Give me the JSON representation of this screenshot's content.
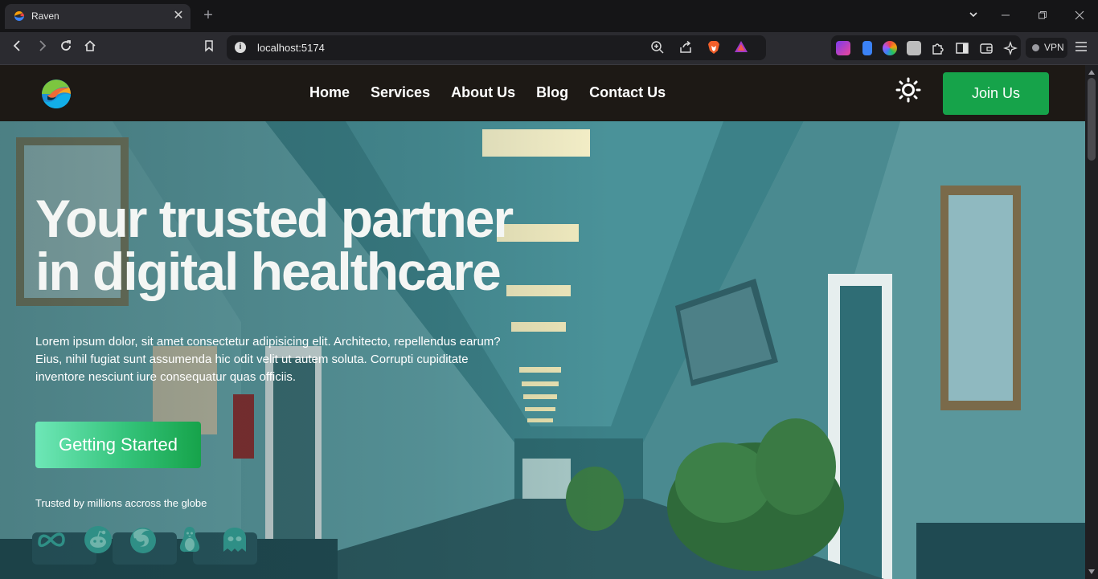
{
  "browser": {
    "tab_title": "Raven",
    "tab_close": "✕",
    "new_tab": "+",
    "url": "localhost:5174",
    "vpn_label": "VPN"
  },
  "site": {
    "nav": {
      "items": [
        {
          "label": "Home"
        },
        {
          "label": "Services"
        },
        {
          "label": "About Us"
        },
        {
          "label": "Blog"
        },
        {
          "label": "Contact Us"
        }
      ],
      "theme_icon": "sun-icon",
      "join_label": "Join Us"
    },
    "hero": {
      "headline_line1": "Your trusted partner",
      "headline_line2": "in digital healthcare",
      "body": "Lorem ipsum dolor, sit amet consectetur adipisicing elit. Architecto, repellendus earum? Eius, nihil fugiat sunt assumenda hic odit velit ut autem soluta. Corrupti cupiditate inventore nesciunt iure consequatur quas officiis.",
      "cta_label": "Getting Started",
      "trusted_text": "Trusted by millions accross the globe",
      "partner_icons": [
        "meta-icon",
        "reddit-icon",
        "firefox-icon",
        "linux-icon",
        "ghost-icon"
      ]
    }
  },
  "colors": {
    "nav_bg": "#1d1915",
    "accent": "#16a34a",
    "cta_gradient_start": "#6ee7b7",
    "partner_icon": "#2f8f86"
  }
}
